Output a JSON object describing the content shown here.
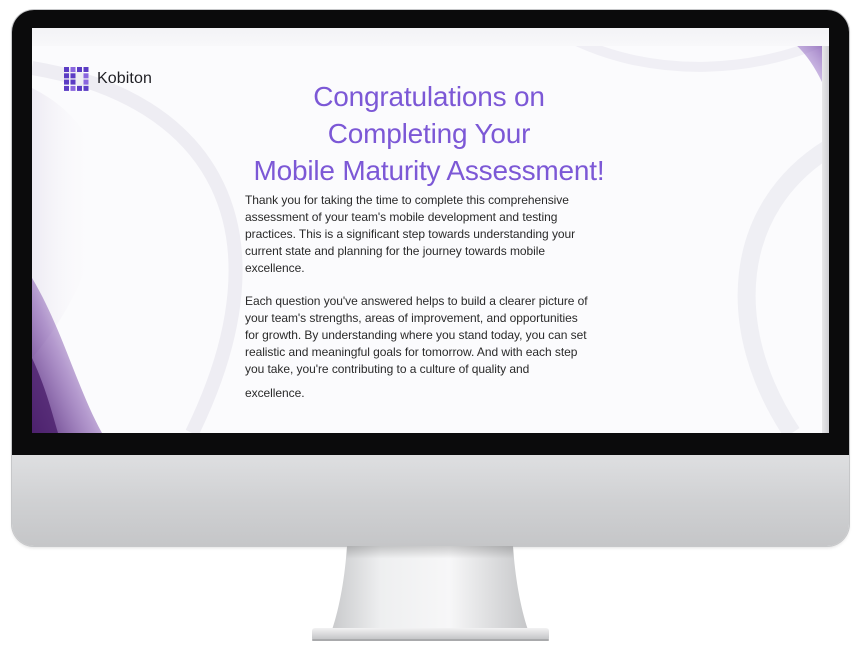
{
  "brand": {
    "name": "Kobiton",
    "logo_icon": "kobiton-logo-icon"
  },
  "page": {
    "title_lines": [
      "Congratulations on",
      "Completing Your",
      "Mobile Maturity Assessment!"
    ],
    "paragraph1_lines": [
      "Thank you for taking the time to complete this comprehensive",
      "assessment of your team's mobile development and testing",
      "practices. This is a significant step towards understanding your",
      "current state and planning for the journey towards mobile",
      "excellence."
    ],
    "paragraph2_lines": [
      "Each question you've answered helps to build a clearer picture of",
      "your team's strengths, areas of improvement, and opportunities",
      "for growth. By understanding where you stand today, you can set",
      "realistic and meaningful goals for tomorrow. And with each step",
      "you take, you're contributing to a culture of quality and"
    ],
    "closing_line": "excellence."
  },
  "colors": {
    "accent": "#7c58d6",
    "text": "#2a2a2a",
    "logo": "#5b3cc4",
    "bezel": "#0b0b0c",
    "chin": "#d0d1d3",
    "wave_purple": "#5e2f8c"
  }
}
